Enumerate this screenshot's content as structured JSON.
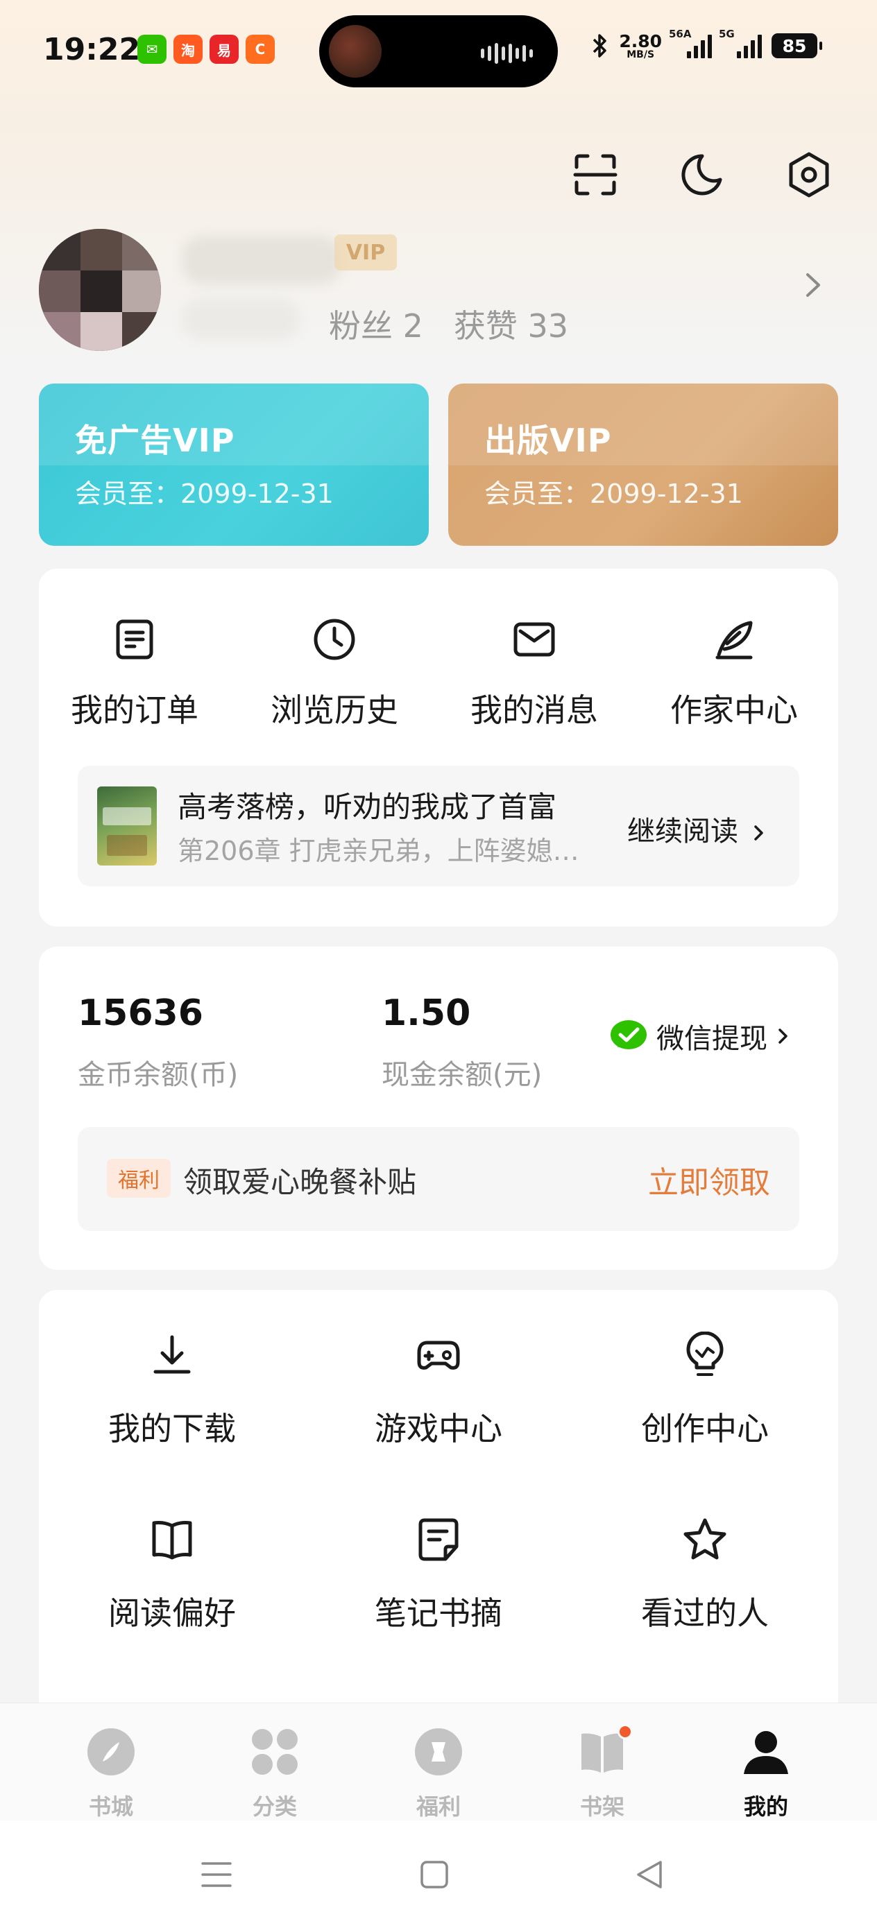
{
  "status_bar": {
    "time": "19:22",
    "app_badges": [
      {
        "name": "wechat-app-icon",
        "glyph": "✉",
        "color": "#2dc100"
      },
      {
        "name": "taobao-app-icon",
        "glyph": "淘",
        "color": "#ff5a1f"
      },
      {
        "name": "campus-app-icon",
        "glyph": "易",
        "color": "#e8262a"
      },
      {
        "name": "fourthapp-app-icon",
        "glyph": "C",
        "color": "#ff6d1f"
      }
    ],
    "net_speed_value": "2.80",
    "net_speed_unit": "MB/S",
    "signal1_tag": "56A",
    "signal2_tag": "5G",
    "battery": "85"
  },
  "profile": {
    "vip_badge": "VIP",
    "fans": "粉丝 2",
    "likes": "获赞 33"
  },
  "vip_cards": [
    {
      "title": "免广告VIP",
      "expire": "会员至：2099-12-31"
    },
    {
      "title": "出版VIP",
      "expire": "会员至：2099-12-31"
    }
  ],
  "quick_actions": [
    {
      "label": "我的订单",
      "icon": "order-icon"
    },
    {
      "label": "浏览历史",
      "icon": "clock-icon"
    },
    {
      "label": "我的消息",
      "icon": "mail-icon"
    },
    {
      "label": "作家中心",
      "icon": "quill-icon"
    }
  ],
  "continue_reading": {
    "book_title": "高考落榜，听劝的我成了首富",
    "chapter": "第206章 打虎亲兄弟，上阵婆媳…",
    "action": "继续阅读"
  },
  "wallet": {
    "coins": "15636",
    "coins_label": "金币余额(币)",
    "cash": "1.50",
    "cash_label": "现金余额(元)",
    "withdraw_label": "微信提现"
  },
  "welfare": {
    "tag": "福利",
    "text": "领取爱心晚餐补贴",
    "action": "立即领取"
  },
  "tools": [
    {
      "label": "我的下载",
      "icon": "download-icon"
    },
    {
      "label": "游戏中心",
      "icon": "gamepad-icon"
    },
    {
      "label": "创作中心",
      "icon": "bulb-icon"
    },
    {
      "label": "阅读偏好",
      "icon": "book-icon"
    },
    {
      "label": "笔记书摘",
      "icon": "note-icon"
    },
    {
      "label": "看过的人",
      "icon": "star-icon"
    }
  ],
  "bottom_nav": [
    {
      "label": "书城",
      "icon": "compass-icon",
      "active": false
    },
    {
      "label": "分类",
      "icon": "grid-icon",
      "active": false
    },
    {
      "label": "福利",
      "icon": "gift-icon",
      "active": false
    },
    {
      "label": "书架",
      "icon": "bookshelf-icon",
      "active": false
    },
    {
      "label": "我的",
      "icon": "user-icon",
      "active": true
    }
  ],
  "colors": {
    "accent_orange": "#e47d3c",
    "vip_ad_teal": "#45cdd9",
    "vip_pub_gold": "#d9a571",
    "wechat_green": "#2dc100"
  }
}
